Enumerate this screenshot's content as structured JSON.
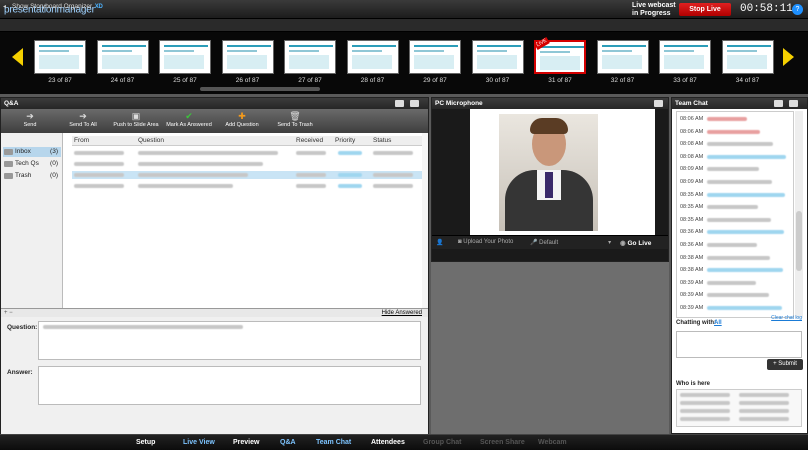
{
  "app": {
    "logo_text": "presentationmanager",
    "logo_sup": "XD"
  },
  "status": {
    "webcast_line1": "Live webcast",
    "webcast_line2": "in Progress",
    "stop_live": "Stop Live",
    "timer": "00:58:11",
    "help": "?"
  },
  "storyboard": {
    "toggle": "◂",
    "label": "Show Storyboard Organizer"
  },
  "slides": [
    {
      "caption": "23 of 87"
    },
    {
      "caption": "24 of 87"
    },
    {
      "caption": "25 of 87"
    },
    {
      "caption": "26 of 87"
    },
    {
      "caption": "27 of 87"
    },
    {
      "caption": "28 of 87"
    },
    {
      "caption": "29 of 87"
    },
    {
      "caption": "30 of 87"
    },
    {
      "caption": "31 of 87"
    },
    {
      "caption": "32 of 87"
    },
    {
      "caption": "33 of 87"
    },
    {
      "caption": "34 of 87"
    }
  ],
  "live_badge": "LIVE",
  "qa": {
    "title": "Q&A",
    "toolbar": [
      {
        "label": "Send",
        "icon": "send-icon",
        "glyph": "➔"
      },
      {
        "label": "Send To All",
        "icon": "send-all-icon",
        "glyph": "➔"
      },
      {
        "label": "Push to Slide Area",
        "icon": "push-slide-icon",
        "glyph": "▣"
      },
      {
        "label": "Mark As Answered",
        "icon": "check-icon",
        "glyph": "✔"
      },
      {
        "label": "Add Question",
        "icon": "plus-icon",
        "glyph": "✚"
      },
      {
        "label": "Send To Trash",
        "icon": "trash-icon",
        "glyph": "🗑"
      }
    ],
    "folders": [
      {
        "name": "Inbox",
        "count": "(3)"
      },
      {
        "name": "Tech Qs",
        "count": "(0)"
      },
      {
        "name": "Trash",
        "count": "(0)"
      }
    ],
    "columns": [
      "From",
      "Question",
      "Received",
      "Priority",
      "Status"
    ],
    "hide_answered": "Hide Answered",
    "question_label": "Question:",
    "answer_label": "Answer:",
    "expand_controls": "+ −"
  },
  "mic": {
    "title": "PC Microphone",
    "upload_photo": "Upload Your Photo",
    "device": "Default",
    "go_live": "Go Live",
    "signal_icon": "signal-bars-icon"
  },
  "chat": {
    "title": "Team Chat",
    "times": [
      "08:06 AM",
      "08:06 AM",
      "08:08 AM",
      "08:08 AM",
      "08:09 AM",
      "08:09 AM",
      "08:35 AM",
      "08:35 AM",
      "08:35 AM",
      "08:36 AM",
      "08:36 AM",
      "08:38 AM",
      "08:38 AM",
      "08:39 AM",
      "08:39 AM",
      "08:39 AM"
    ],
    "clear_log": "Clear chat log",
    "chatting_with": "Chatting with:",
    "chat_target": "All",
    "submit": "+ Submit",
    "who_is_here": "Who is here"
  },
  "nav": [
    {
      "label": "Setup",
      "state": "normal"
    },
    {
      "label": "Live View",
      "state": "active"
    },
    {
      "label": "Preview",
      "state": "normal"
    },
    {
      "label": "Q&A",
      "state": "active"
    },
    {
      "label": "Team Chat",
      "state": "active"
    },
    {
      "label": "Attendees",
      "state": "normal"
    },
    {
      "label": "Group Chat",
      "state": "dim"
    },
    {
      "label": "Screen Share",
      "state": "dim"
    },
    {
      "label": "Webcam",
      "state": "dim"
    }
  ],
  "colors": {
    "accent": "#1e90ff",
    "stop": "#d40000",
    "arrow": "#f5d000"
  }
}
